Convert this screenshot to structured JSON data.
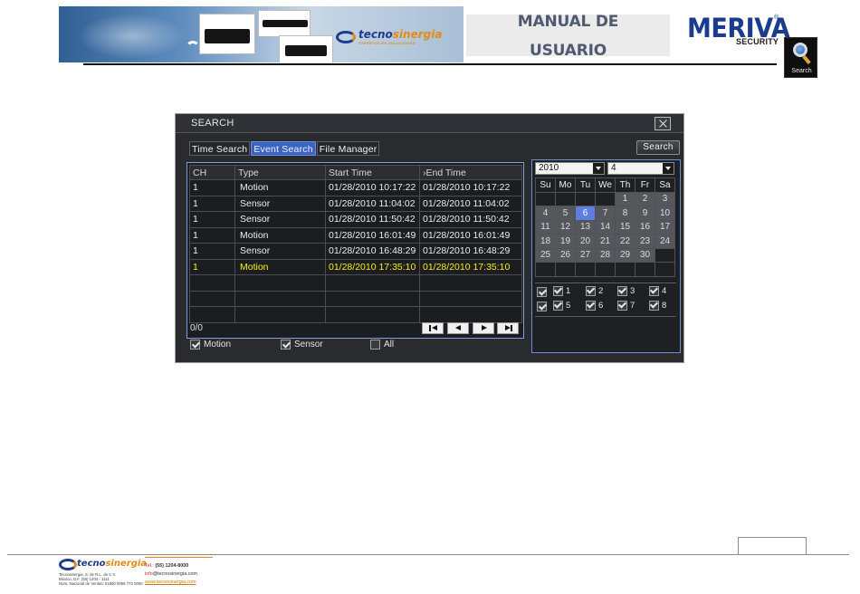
{
  "header": {
    "banner_brand_main": "tecno",
    "banner_brand_accent": "sinergia",
    "banner_brand_sub": "EXPERTOS EN SOLUCIONES",
    "manual_line1": "MANUAL DE",
    "manual_line2": "USUARIO",
    "meriva_name": "MERIVA",
    "meriva_reg": "®",
    "meriva_sub": "SECURITY",
    "search_badge_label": "Search"
  },
  "window": {
    "title": "SEARCH",
    "tabs": [
      {
        "label": "Time Search",
        "active": false
      },
      {
        "label": "Event Search",
        "active": true
      },
      {
        "label": "File Manager",
        "active": false
      }
    ],
    "search_button": "Search",
    "columns": [
      "CH",
      "Type",
      "Start Time",
      "End Time"
    ],
    "rows": [
      {
        "ch": "1",
        "type": "Motion",
        "start": "01/28/2010  10:17:22",
        "end": "01/28/2010  10:17:22",
        "selected": false
      },
      {
        "ch": "1",
        "type": "Sensor",
        "start": "01/28/2010  11:04:02",
        "end": "01/28/2010  11:04:02",
        "selected": false
      },
      {
        "ch": "1",
        "type": "Sensor",
        "start": "01/28/2010  11:50:42",
        "end": "01/28/2010  11:50:42",
        "selected": false
      },
      {
        "ch": "1",
        "type": "Motion",
        "start": "01/28/2010  16:01:49",
        "end": "01/28/2010  16:01:49",
        "selected": false
      },
      {
        "ch": "1",
        "type": "Sensor",
        "start": "01/28/2010  16:48:29",
        "end": "01/28/2010  16:48:29",
        "selected": false
      },
      {
        "ch": "1",
        "type": "Motion",
        "start": "01/28/2010  17:35:10",
        "end": "01/28/2010  17:35:10",
        "selected": true
      }
    ],
    "page_count": "0/0",
    "filters": [
      {
        "label": "Motion",
        "checked": true
      },
      {
        "label": "Sensor",
        "checked": true
      },
      {
        "label": "All",
        "checked": false
      }
    ],
    "calendar": {
      "year": "2010",
      "month": "4",
      "weekdays": [
        "Su",
        "Mo",
        "Tu",
        "We",
        "Th",
        "Fr",
        "Sa"
      ],
      "weeks": [
        [
          "",
          "",
          "",
          "",
          "1",
          "2",
          "3"
        ],
        [
          "4",
          "5",
          "6",
          "7",
          "8",
          "9",
          "10"
        ],
        [
          "11",
          "12",
          "13",
          "14",
          "15",
          "16",
          "17"
        ],
        [
          "18",
          "19",
          "20",
          "21",
          "22",
          "23",
          "24"
        ],
        [
          "25",
          "26",
          "27",
          "28",
          "29",
          "30",
          ""
        ],
        [
          "",
          "",
          "",
          "",
          "",
          "",
          ""
        ]
      ],
      "today": "6"
    },
    "channels": [
      "1",
      "2",
      "3",
      "4",
      "5",
      "6",
      "7",
      "8"
    ]
  },
  "footer": {
    "brand_main": "tecno",
    "brand_accent": "sinergia",
    "address_lines": [
      "Tecnosinergia, S. de R.L. de C.V.",
      "México, D.F. (55) 1204 - 1111",
      "Num. Nacional de Ventas: 01800 0055 772 0000"
    ],
    "tel_label": "Tel.:",
    "tel": "(55) 1204-8000",
    "email_prefix": "info",
    "email_domain": "@tecnosinergia.com",
    "web": "www.tecnosinergia.com"
  },
  "colors": {
    "window_bg": "#2a2b2f",
    "active_tab": "#3a63c4",
    "selected_row_text": "#f5f01e",
    "calendar_today": "#5f7de0",
    "brand_blue": "#1e3d8a",
    "brand_orange": "#e38b16"
  }
}
